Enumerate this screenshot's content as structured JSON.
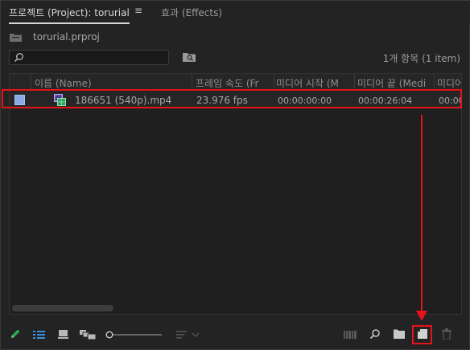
{
  "tabs": {
    "project": "프로젝트 (Project): torurial",
    "menu": "≡",
    "effects": "효과 (Effects)"
  },
  "project": {
    "filename": "torurial.prproj"
  },
  "search": {
    "placeholder": ""
  },
  "item_count": "1개 항목 (1 item)",
  "columns": {
    "name": "이름 (Name)",
    "frame_rate": "프레임 속도 (Fr",
    "media_start": "미디어 시작 (M",
    "media_end": "미디어 끝 (Medi",
    "media_more": "미디어"
  },
  "rows": [
    {
      "name": "186651 (540p).mp4",
      "frame_rate": "23.976 fps",
      "media_start": "00:00:00:00",
      "media_end": "00:00:26:04",
      "media_more": "00:00"
    }
  ],
  "colors": {
    "highlight": "#e8121a",
    "label_swatch": "#8aa9e6",
    "accent_green": "#2fa84f",
    "accent_blue": "#3b8fe0"
  },
  "toolbar_icons": [
    "pencil-icon",
    "list-view-icon",
    "icon-view-icon",
    "freeform-view-icon",
    "zoom-slider",
    "sort-icon",
    "automate-to-sequence-icon",
    "find-icon",
    "new-bin-icon",
    "new-item-icon",
    "trash-icon"
  ]
}
